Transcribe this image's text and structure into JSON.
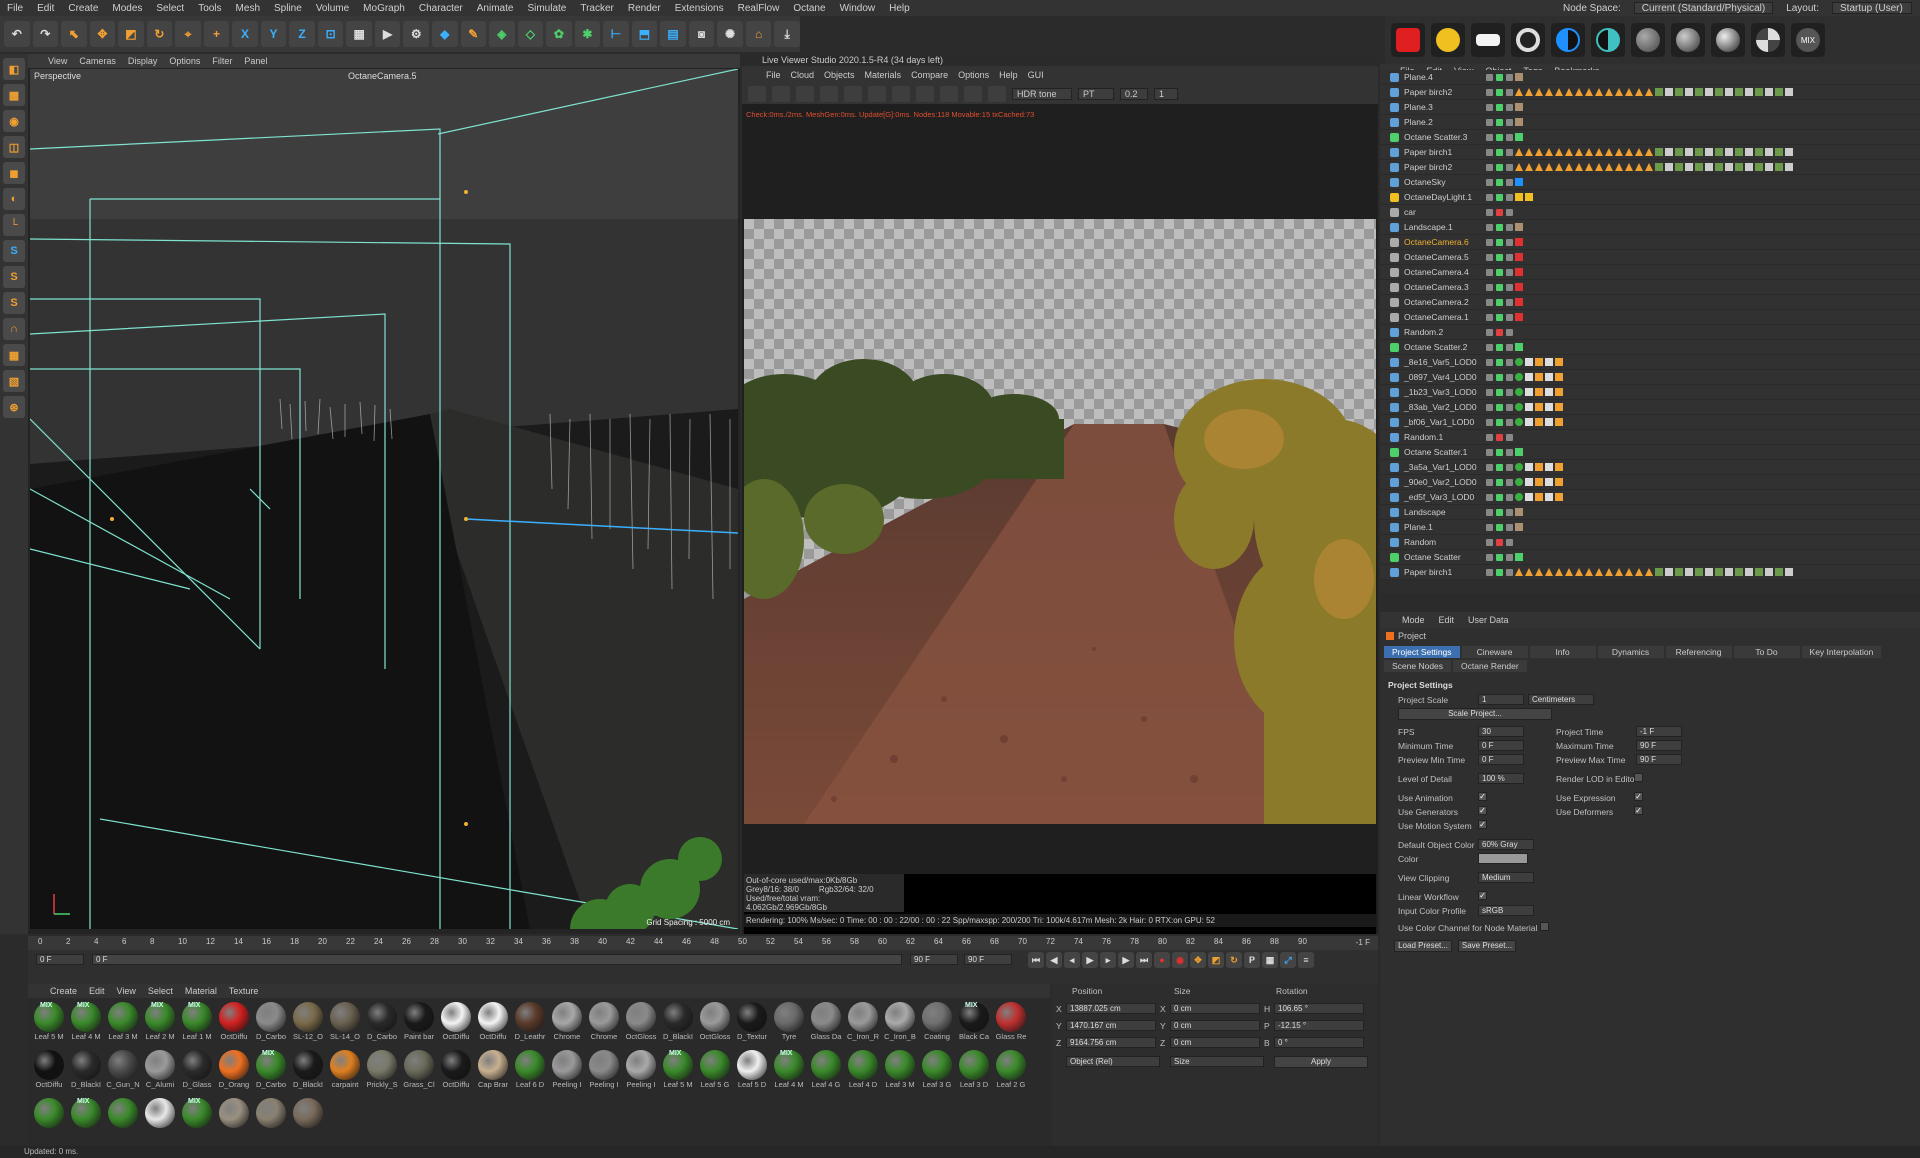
{
  "menubar": {
    "items": [
      "File",
      "Edit",
      "Create",
      "Modes",
      "Select",
      "Tools",
      "Mesh",
      "Spline",
      "Volume",
      "MoGraph",
      "Character",
      "Animate",
      "Simulate",
      "Tracker",
      "Render",
      "Extensions",
      "RealFlow",
      "Octane",
      "Window",
      "Help"
    ],
    "node_space_label": "Node Space:",
    "node_space_value": "Current (Standard/Physical)",
    "layout_label": "Layout:",
    "layout_value": "Startup (User)"
  },
  "viewport": {
    "menu": [
      "View",
      "Cameras",
      "Display",
      "Options",
      "Filter",
      "Panel"
    ],
    "view_name": "Perspective",
    "camera_name": "OctaneCamera.5",
    "grid_spacing": "Grid Spacing : 5000 cm"
  },
  "live_viewer": {
    "title": "Live Viewer Studio 2020.1.5-R4 (34 days left)",
    "menu": [
      "File",
      "Cloud",
      "Objects",
      "Materials",
      "Compare",
      "Options",
      "Help",
      "GUI"
    ],
    "tonemap": "HDR tone",
    "kernel": "PT",
    "value1": "0.2",
    "value2": "1",
    "status": "Check:0ms./2ms. MeshGen:0ms. Update[G]:0ms. Nodes:118 Movable:15 txCached:73",
    "out_of_core": "Out-of-core used/max:0Kb/8Gb",
    "grey": "Grey8/16: 38/0",
    "rgb": "Rgb32/64: 32/0",
    "vram": "Used/free/total vram: 4.062Gb/2.969Gb/8Gb",
    "rendering": "Rendering: 100% Ms/sec: 0   Time: 00 : 00 : 22/00 : 00 : 22   Spp/maxspp: 200/200   Tri: 100k/4.617m   Mesh: 2k   Hair: 0   RTX:on   GPU: 52"
  },
  "object_manager": {
    "menu": [
      "File",
      "Edit",
      "View",
      "Object",
      "Tags",
      "Bookmarks"
    ],
    "objects": [
      {
        "name": "Plane.4",
        "type": "plane",
        "selected": false
      },
      {
        "name": "Paper birch2",
        "type": "mesh",
        "selected": false
      },
      {
        "name": "Plane.3",
        "type": "plane",
        "selected": false
      },
      {
        "name": "Plane.2",
        "type": "plane",
        "selected": false
      },
      {
        "name": "Octane Scatter.3",
        "type": "scatter",
        "selected": false
      },
      {
        "name": "Paper birch1",
        "type": "mesh",
        "selected": false
      },
      {
        "name": "Paper birch2",
        "type": "mesh",
        "selected": false
      },
      {
        "name": "OctaneSky",
        "type": "sky",
        "selected": false
      },
      {
        "name": "OctaneDayLight.1",
        "type": "light",
        "selected": false
      },
      {
        "name": "car",
        "type": "null",
        "selected": false
      },
      {
        "name": "Landscape.1",
        "type": "plane",
        "selected": false
      },
      {
        "name": "OctaneCamera.6",
        "type": "camera",
        "selected": true
      },
      {
        "name": "OctaneCamera.5",
        "type": "camera",
        "selected": false
      },
      {
        "name": "OctaneCamera.4",
        "type": "camera",
        "selected": false
      },
      {
        "name": "OctaneCamera.3",
        "type": "camera",
        "selected": false
      },
      {
        "name": "OctaneCamera.2",
        "type": "camera",
        "selected": false
      },
      {
        "name": "OctaneCamera.1",
        "type": "camera",
        "selected": false
      },
      {
        "name": "Random.2",
        "type": "effector",
        "selected": false
      },
      {
        "name": "Octane Scatter.2",
        "type": "scatter",
        "selected": false
      },
      {
        "name": "_8e16_Var5_LOD0",
        "type": "mesh",
        "selected": false
      },
      {
        "name": "_0897_Var4_LOD0",
        "type": "mesh",
        "selected": false
      },
      {
        "name": "_1b23_Var3_LOD0",
        "type": "mesh",
        "selected": false
      },
      {
        "name": "_83ab_Var2_LOD0",
        "type": "mesh",
        "selected": false
      },
      {
        "name": "_bf06_Var1_LOD0",
        "type": "mesh",
        "selected": false
      },
      {
        "name": "Random.1",
        "type": "effector",
        "selected": false
      },
      {
        "name": "Octane Scatter.1",
        "type": "scatter",
        "selected": false
      },
      {
        "name": "_3a5a_Var1_LOD0",
        "type": "mesh",
        "selected": false
      },
      {
        "name": "_90e0_Var2_LOD0",
        "type": "mesh",
        "selected": false
      },
      {
        "name": "_ed5f_Var3_LOD0",
        "type": "mesh",
        "selected": false
      },
      {
        "name": "Landscape",
        "type": "plane",
        "selected": false
      },
      {
        "name": "Plane.1",
        "type": "plane",
        "selected": false
      },
      {
        "name": "Random",
        "type": "effector",
        "selected": false
      },
      {
        "name": "Octane Scatter",
        "type": "scatter",
        "selected": false
      },
      {
        "name": "Paper birch1",
        "type": "mesh",
        "selected": false
      }
    ]
  },
  "attributes": {
    "menu": [
      "Mode",
      "Edit",
      "User Data"
    ],
    "section": "Project",
    "tabs": [
      "Project Settings",
      "Cineware",
      "Info",
      "Dynamics",
      "Referencing",
      "To Do",
      "Key Interpolation",
      "Scene Nodes",
      "Octane Render"
    ],
    "active_tab": "Project Settings",
    "heading": "Project Settings",
    "project_scale_label": "Project Scale",
    "project_scale_value": "1",
    "project_scale_unit": "Centimeters",
    "scale_project_btn": "Scale Project...",
    "fps_label": "FPS",
    "fps_value": "30",
    "project_time_label": "Project Time",
    "project_time_value": "-1 F",
    "min_time_label": "Minimum Time",
    "min_time_value": "0 F",
    "max_time_label": "Maximum Time",
    "max_time_value": "90 F",
    "prev_min_label": "Preview Min Time",
    "prev_min_value": "0 F",
    "prev_max_label": "Preview Max Time",
    "prev_max_value": "90 F",
    "lod_label": "Level of Detail",
    "lod_value": "100 %",
    "render_lod_label": "Render LOD in Editor",
    "use_anim_label": "Use Animation",
    "use_expr_label": "Use Expression",
    "use_gen_label": "Use Generators",
    "use_def_label": "Use Deformers",
    "use_motion_label": "Use Motion System",
    "def_color_label": "Default Object Color",
    "def_color_value": "60% Gray",
    "color_label": "Color",
    "view_clip_label": "View Clipping",
    "view_clip_value": "Medium",
    "linear_wf_label": "Linear Workflow",
    "input_profile_label": "Input Color Profile",
    "input_profile_value": "sRGB",
    "use_color_channel_label": "Use Color Channel for Node Material",
    "load_preset": "Load Preset...",
    "save_preset": "Save Preset..."
  },
  "timeline": {
    "ticks": [
      "0",
      "2",
      "4",
      "6",
      "8",
      "10",
      "12",
      "14",
      "16",
      "18",
      "20",
      "22",
      "24",
      "26",
      "28",
      "30",
      "32",
      "34",
      "36",
      "38",
      "40",
      "42",
      "44",
      "46",
      "48",
      "50",
      "52",
      "54",
      "56",
      "58",
      "60",
      "62",
      "64",
      "66",
      "68",
      "70",
      "72",
      "74",
      "76",
      "78",
      "80",
      "82",
      "84",
      "86",
      "88",
      "90"
    ],
    "current": "-1 F",
    "start": "0 F",
    "field2": "0 F",
    "end": "90 F",
    "end2": "90 F"
  },
  "materials": {
    "menu": [
      "Create",
      "Edit",
      "View",
      "Select",
      "Material",
      "Texture"
    ],
    "items": [
      {
        "label": "Leaf 5 M",
        "color": "#3a8a2a",
        "mix": true
      },
      {
        "label": "Leaf 4 M",
        "color": "#3a8a2a",
        "mix": true
      },
      {
        "label": "Leaf 3 M",
        "color": "#3a8a2a",
        "mix": false
      },
      {
        "label": "Leaf 2 M",
        "color": "#3a8a2a",
        "mix": true
      },
      {
        "label": "Leaf 1 M",
        "color": "#3a8a2a",
        "mix": true
      },
      {
        "label": "OctDiffu",
        "color": "#d42020",
        "mix": false
      },
      {
        "label": "D_Carbo",
        "color": "#8a8a8a",
        "mix": false
      },
      {
        "label": "SL-12_O",
        "color": "#7a6a4a",
        "mix": false
      },
      {
        "label": "SL-14_O",
        "color": "#6a6050",
        "mix": false
      },
      {
        "label": "D_Carbo",
        "color": "#2a2a2a",
        "mix": false
      },
      {
        "label": "Paint bar",
        "color": "#1a1a1a",
        "mix": false
      },
      {
        "label": "OctDiffu",
        "color": "#f4f4f4",
        "mix": false
      },
      {
        "label": "OctDiffu",
        "color": "#f4f4f4",
        "mix": false
      },
      {
        "label": "D_Leathr",
        "color": "#5a3a2a",
        "mix": false
      },
      {
        "label": "Chrome",
        "color": "#a8a8a8",
        "mix": false
      },
      {
        "label": "Chrome",
        "color": "#9a9a9a",
        "mix": false
      },
      {
        "label": "OctGloss",
        "color": "#8a8a8a",
        "mix": false
      },
      {
        "label": "D_BlackI",
        "color": "#2a2a2a",
        "mix": false
      },
      {
        "label": "OctGloss",
        "color": "#9a9a9a",
        "mix": false
      },
      {
        "label": "D_Textur",
        "color": "#1a1a1a",
        "mix": false
      },
      {
        "label": "Tyre",
        "color": "#6a6a6a",
        "mix": false
      },
      {
        "label": "Glass Da",
        "color": "#8a8a8a",
        "mix": false
      },
      {
        "label": "C_Iron_R",
        "color": "#9a9a9a",
        "mix": false
      },
      {
        "label": "C_Iron_B",
        "color": "#aaaaaa",
        "mix": false
      },
      {
        "label": "Coating",
        "color": "#707070",
        "mix": false
      },
      {
        "label": "Black Ca",
        "color": "#1a1a1a",
        "mix": true
      },
      {
        "label": "Glass Re",
        "color": "#c03030",
        "mix": false
      },
      {
        "label": "OctDiffu",
        "color": "#111111",
        "mix": false
      },
      {
        "label": "D_BlackI",
        "color": "#2a2a2a",
        "mix": false
      },
      {
        "label": "C_Gun_N",
        "color": "#4a4a4a",
        "mix": false
      },
      {
        "label": "C_Alumi",
        "color": "#9a9a9a",
        "mix": false
      },
      {
        "label": "D_Glass",
        "color": "#2a2a2a",
        "mix": false
      },
      {
        "label": "D_Orang",
        "color": "#f07020",
        "mix": false
      },
      {
        "label": "D_Carbo",
        "color": "#3a8a2a",
        "mix": true
      },
      {
        "label": "D_BlackI",
        "color": "#1a1a1a",
        "mix": false
      },
      {
        "label": "carpaint",
        "color": "#e08020",
        "mix": false
      },
      {
        "label": "Prickly_S",
        "color": "#7a7a6a",
        "mix": false
      },
      {
        "label": "Grass_Cl",
        "color": "#6a6a5a",
        "mix": false
      },
      {
        "label": "OctDiffu",
        "color": "#1a1a1a",
        "mix": false
      },
      {
        "label": "Cap Brar",
        "color": "#c8b090",
        "mix": false
      },
      {
        "label": "Leaf 6 D",
        "color": "#3a8a2a",
        "mix": false
      },
      {
        "label": "Peeling I",
        "color": "#9a9a9a",
        "mix": false
      },
      {
        "label": "Peeling I",
        "color": "#8a8a8a",
        "mix": false
      },
      {
        "label": "Peeling I",
        "color": "#aaaaaa",
        "mix": false
      },
      {
        "label": "Leaf 5 M",
        "color": "#3a8a2a",
        "mix": true
      },
      {
        "label": "Leaf 5 G",
        "color": "#3a8a2a",
        "mix": false
      },
      {
        "label": "Leaf 5 D",
        "color": "#f0f0f0",
        "mix": false
      },
      {
        "label": "Leaf 4 M",
        "color": "#3a8a2a",
        "mix": true
      },
      {
        "label": "Leaf 4 G",
        "color": "#3a8a2a",
        "mix": false
      },
      {
        "label": "Leaf 4 D",
        "color": "#3a8a2a",
        "mix": false
      },
      {
        "label": "Leaf 3 M",
        "color": "#3a8a2a",
        "mix": false
      },
      {
        "label": "Leaf 3 G",
        "color": "#3a8a2a",
        "mix": false
      },
      {
        "label": "Leaf 3 D",
        "color": "#3a8a2a",
        "mix": false
      },
      {
        "label": "Leaf 2 G",
        "color": "#3a8a2a",
        "mix": false
      },
      {
        "label": "",
        "color": "#3a8a2a",
        "mix": false
      },
      {
        "label": "",
        "color": "#3a8a2a",
        "mix": true
      },
      {
        "label": "",
        "color": "#3a8a2a",
        "mix": false
      },
      {
        "label": "",
        "color": "#e8e8e8",
        "mix": false
      },
      {
        "label": "",
        "color": "#3a8a2a",
        "mix": true
      },
      {
        "label": "",
        "color": "#9a9080",
        "mix": false
      },
      {
        "label": "",
        "color": "#8a8070",
        "mix": false
      },
      {
        "label": "",
        "color": "#7a6a5a",
        "mix": false
      }
    ]
  },
  "coordinates": {
    "position_label": "Position",
    "size_label": "Size",
    "rotation_label": "Rotation",
    "x_pos": "13887.025 cm",
    "y_pos": "1470.167 cm",
    "z_pos": "9164.756 cm",
    "x_size": "0 cm",
    "y_size": "0 cm",
    "z_size": "0 cm",
    "h_rot": "106.65 °",
    "p_rot": "-12.15 °",
    "b_rot": "0 °",
    "mode": "Object (Rel)",
    "size_mode": "Size",
    "apply": "Apply"
  },
  "status": "Updated: 0 ms."
}
